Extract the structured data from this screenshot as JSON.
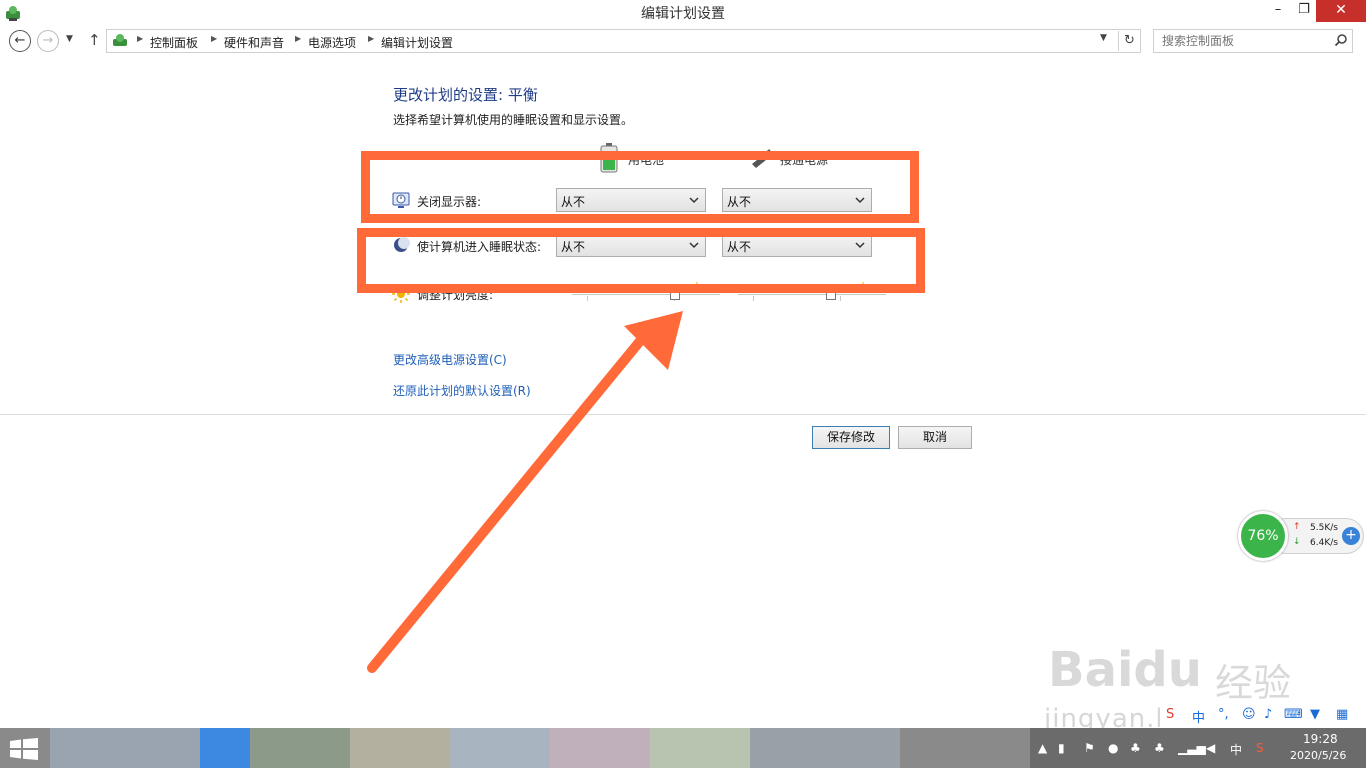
{
  "window": {
    "title": "编辑计划设置",
    "min_glyph": "–",
    "max_glyph": "❐",
    "close_glyph": "✕"
  },
  "address": {
    "crumbs": [
      "控制面板",
      "硬件和声音",
      "电源选项",
      "编辑计划设置"
    ],
    "search_placeholder": "搜索控制面板"
  },
  "content": {
    "heading": "更改计划的设置: 平衡",
    "subheading": "选择希望计算机使用的睡眠设置和显示设置。",
    "columns": {
      "battery": "用电池",
      "plugged": "接通电源"
    },
    "rows": [
      {
        "label": "关闭显示器:",
        "battery": "从不",
        "plugged": "从不"
      },
      {
        "label": "使计算机进入睡眠状态:",
        "battery": "从不",
        "plugged": "从不"
      },
      {
        "label": "调整计划亮度:"
      }
    ],
    "links": [
      "更改高级电源设置(C)",
      "还原此计划的默认设置(R)"
    ],
    "save_label": "保存修改",
    "cancel_label": "取消"
  },
  "network_widget": {
    "percent": "76%",
    "upload": "5.5K/s",
    "download": "6.4K/s"
  },
  "watermark": {
    "brand": "Baidu",
    "product": "经验",
    "url": "jingyan.baidu.com"
  },
  "taskbar": {
    "time": "19:28",
    "date": "2020/5/26",
    "ime": "中"
  },
  "colors": {
    "annotation": "#ff6a38",
    "heading": "#1f3d86",
    "link": "#1f5fb8",
    "close_button": "#c7302a"
  }
}
